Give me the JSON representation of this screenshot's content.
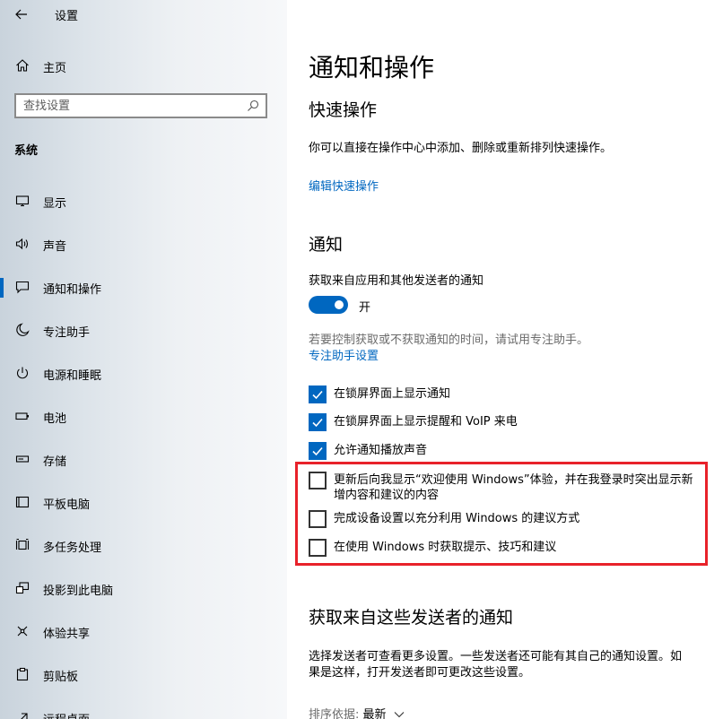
{
  "window": {
    "title": "设置"
  },
  "sidebar": {
    "home_label": "主页",
    "search": {
      "placeholder": "查找设置",
      "value": ""
    },
    "section": "系统",
    "items": [
      {
        "label": "显示",
        "icon": "monitor-icon"
      },
      {
        "label": "声音",
        "icon": "speaker-icon"
      },
      {
        "label": "通知和操作",
        "icon": "notification-icon",
        "active": true
      },
      {
        "label": "专注助手",
        "icon": "moon-icon"
      },
      {
        "label": "电源和睡眠",
        "icon": "power-icon"
      },
      {
        "label": "电池",
        "icon": "battery-icon"
      },
      {
        "label": "存储",
        "icon": "storage-icon"
      },
      {
        "label": "平板电脑",
        "icon": "tablet-icon"
      },
      {
        "label": "多任务处理",
        "icon": "multitask-icon"
      },
      {
        "label": "投影到此电脑",
        "icon": "project-icon"
      },
      {
        "label": "体验共享",
        "icon": "share-icon"
      },
      {
        "label": "剪贴板",
        "icon": "clipboard-icon"
      },
      {
        "label": "远程桌面",
        "icon": "remote-desktop-icon"
      }
    ]
  },
  "main": {
    "title": "通知和操作",
    "quick_actions": {
      "heading": "快速操作",
      "description": "你可以直接在操作中心中添加、删除或重新排列快速操作。",
      "edit_link": "编辑快速操作"
    },
    "notifications": {
      "heading": "通知",
      "toggle_label": "获取来自应用和其他发送者的通知",
      "toggle_state": "开",
      "toggle_on": true,
      "focus_hint": "若要控制获取或不获取通知的时间，请试用专注助手。",
      "focus_link": "专注助手设置",
      "checkboxes": [
        {
          "label": "在锁屏界面上显示通知",
          "checked": true
        },
        {
          "label": "在锁屏界面上显示提醒和 VoIP 来电",
          "checked": true
        },
        {
          "label": "允许通知播放声音",
          "checked": true
        },
        {
          "label": "更新后向我显示“欢迎使用 Windows”体验，并在我登录时突出显示新增内容和建议的内容",
          "checked": false
        },
        {
          "label": "完成设备设置以充分利用 Windows 的建议方式",
          "checked": false
        },
        {
          "label": "在使用 Windows 时获取提示、技巧和建议",
          "checked": false
        }
      ]
    },
    "senders": {
      "heading": "获取来自这些发送者的通知",
      "description_line1": "选择发送者可查看更多设置。一些发送者还可能有其自己的通知设置。如",
      "description_line2": "果是这样，打开发送者即可更改这些设置。",
      "sort_label": "排序依据:",
      "sort_value": "最新"
    }
  },
  "colors": {
    "accent": "#0067c0",
    "highlight_border": "#e8222a"
  }
}
